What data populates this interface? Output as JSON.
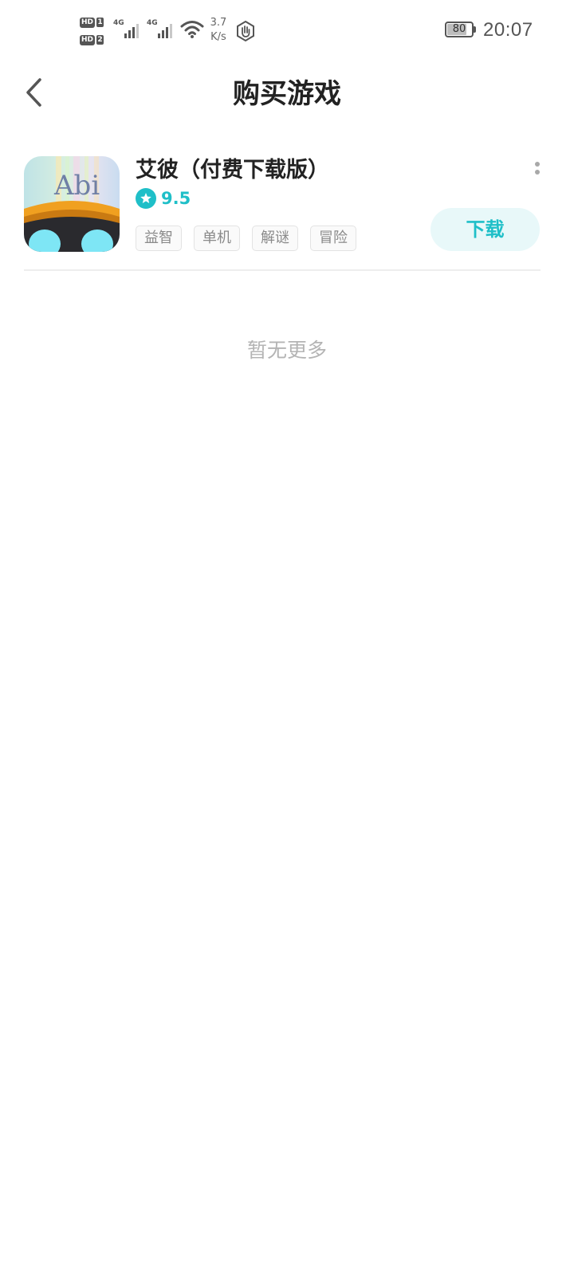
{
  "status_bar": {
    "sim1_label": "HD",
    "sim1_number": "1",
    "sim2_label": "HD",
    "sim2_number": "2",
    "network1": "4G",
    "network2": "4G",
    "speed_value": "3.7",
    "speed_unit": "K/s",
    "battery_level": "80",
    "time": "20:07"
  },
  "header": {
    "title": "购买游戏",
    "back_icon": "chevron-left-icon"
  },
  "game": {
    "icon_text": "Abi",
    "name": "艾彼（付费下载版）",
    "rating": "9.5",
    "tags": [
      "益智",
      "单机",
      "解谜",
      "冒险"
    ],
    "download_label": "下载",
    "more_icon": "more-vertical-icon"
  },
  "list_footer": {
    "no_more_text": "暂无更多"
  },
  "colors": {
    "accent": "#1fbfc8",
    "accent_light": "#e8f8f9",
    "title_text": "#222222",
    "muted_text": "#b4b4b4"
  }
}
